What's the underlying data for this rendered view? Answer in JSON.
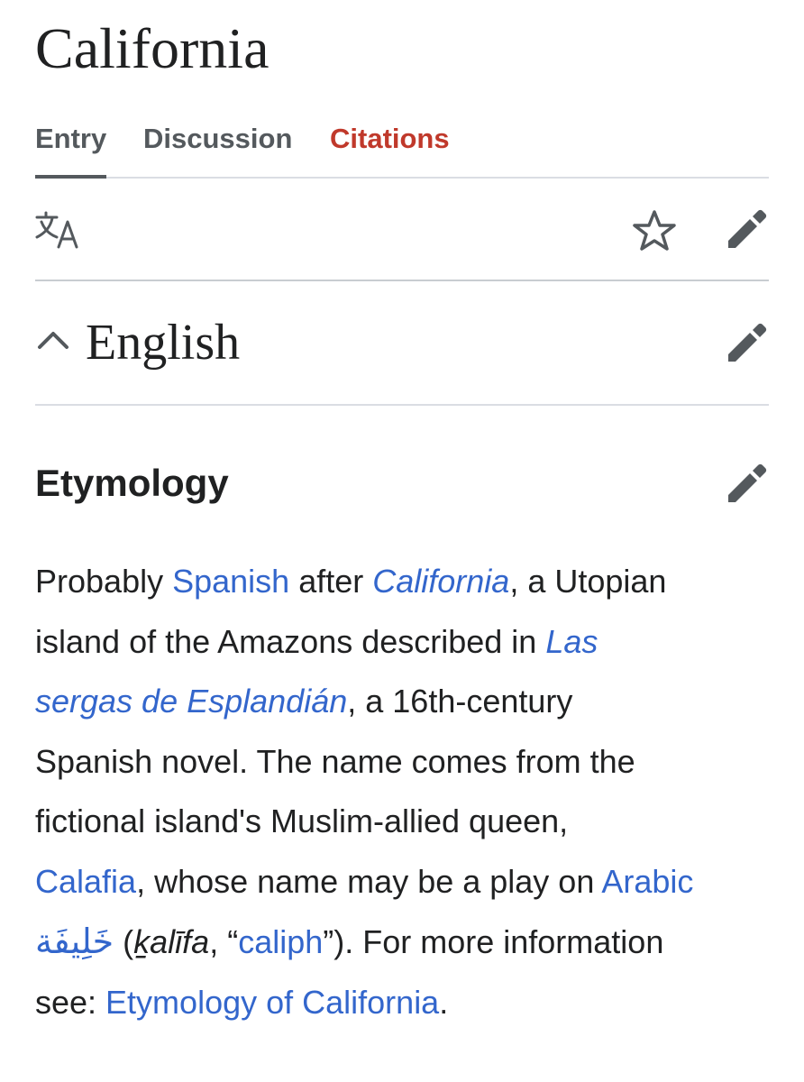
{
  "page": {
    "title": "California"
  },
  "tabs": [
    {
      "label": "Entry",
      "state": "selected"
    },
    {
      "label": "Discussion",
      "state": "normal"
    },
    {
      "label": "Citations",
      "state": "link-red"
    }
  ],
  "toolbar": {
    "language_icon": "translate-icon",
    "watch_icon": "star-icon",
    "edit_icon": "pencil-icon"
  },
  "section": {
    "title": "English",
    "collapse_icon": "chevron-up-icon",
    "edit_icon": "pencil-icon"
  },
  "subsection": {
    "title": "Etymology",
    "edit_icon": "pencil-icon"
  },
  "etymology": {
    "line1": {
      "t1": "Probably ",
      "link_spanish": "Spanish",
      "t2": " after ",
      "link_california": "California",
      "t3": ", a Utopian"
    },
    "line2": {
      "t1": "island of the Amazons described in ",
      "link_las": "Las"
    },
    "line3": {
      "link_sergas": "sergas de Esplandián",
      "t1": ", a 16th-century"
    },
    "line4": {
      "t1": "Spanish novel. The name comes from the"
    },
    "line5": {
      "t1": "fictional island's Muslim-allied queen,"
    },
    "line6": {
      "link_calafia": "Calafia",
      "t1": ", whose name may be a play on ",
      "link_arabic": "Arabic"
    },
    "line7": {
      "arabic_word": "خَلِيفَة",
      "t1": " (",
      "translit": "ḵalīfa",
      "t2": ", “",
      "link_caliph": "caliph",
      "t3": "”). For more information"
    },
    "line8": {
      "t1": "see: ",
      "link_etymology": "Etymology of California",
      "t2": "."
    }
  },
  "colors": {
    "link": "#3366cc",
    "link_red": "#c0392b",
    "text": "#202122",
    "tab_text": "#54595d",
    "divider": "#dadde3"
  }
}
